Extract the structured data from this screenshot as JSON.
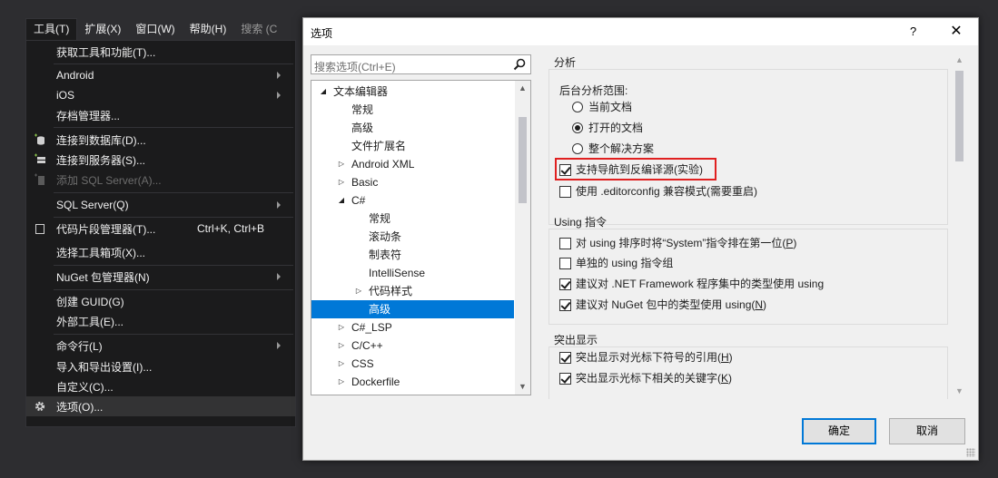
{
  "menubar": {
    "items": [
      "工具(T)",
      "扩展(X)",
      "窗口(W)",
      "帮助(H)",
      "搜索 (C"
    ]
  },
  "tools_menu": {
    "items": [
      {
        "label": "获取工具和功能(T)..."
      },
      {
        "label": "Android",
        "submenu": true
      },
      {
        "label": "iOS",
        "submenu": true
      },
      {
        "label": "存档管理器..."
      },
      {
        "label": "连接到数据库(D)...",
        "icon": "database-connect-icon"
      },
      {
        "label": "连接到服务器(S)...",
        "icon": "server-connect-icon"
      },
      {
        "label": "添加 SQL Server(A)...",
        "icon": "sql-server-add-icon",
        "disabled": true
      },
      {
        "label": "SQL Server(Q)",
        "submenu": true
      },
      {
        "label": "代码片段管理器(T)...",
        "shortcut": "Ctrl+K, Ctrl+B",
        "icon": "snippet-icon"
      },
      {
        "label": "选择工具箱项(X)..."
      },
      {
        "label": "NuGet 包管理器(N)",
        "submenu": true
      },
      {
        "label": "创建 GUID(G)"
      },
      {
        "label": "外部工具(E)..."
      },
      {
        "label": "命令行(L)",
        "submenu": true
      },
      {
        "label": "导入和导出设置(I)..."
      },
      {
        "label": "自定义(C)..."
      },
      {
        "label": "选项(O)...",
        "icon": "gear-icon",
        "highlighted": true
      }
    ]
  },
  "dialog": {
    "title": "选项",
    "help": "?",
    "close": "✕",
    "search_placeholder": "搜索选项(Ctrl+E)",
    "tree": [
      {
        "label": "文本编辑器",
        "level": 0,
        "expander": "expanded"
      },
      {
        "label": "常规",
        "level": 1
      },
      {
        "label": "高级",
        "level": 1
      },
      {
        "label": "文件扩展名",
        "level": 1
      },
      {
        "label": "Android XML",
        "level": 1,
        "expander": "collapsed"
      },
      {
        "label": "Basic",
        "level": 1,
        "expander": "collapsed"
      },
      {
        "label": "C#",
        "level": 1,
        "expander": "expanded"
      },
      {
        "label": "常规",
        "level": 2
      },
      {
        "label": "滚动条",
        "level": 2
      },
      {
        "label": "制表符",
        "level": 2
      },
      {
        "label": "IntelliSense",
        "level": 2
      },
      {
        "label": "代码样式",
        "level": 2,
        "expander": "collapsed"
      },
      {
        "label": "高级",
        "level": 2,
        "selected": true
      },
      {
        "label": "C#_LSP",
        "level": 1,
        "expander": "collapsed"
      },
      {
        "label": "C/C++",
        "level": 1,
        "expander": "collapsed"
      },
      {
        "label": "CSS",
        "level": 1,
        "expander": "collapsed"
      },
      {
        "label": "Dockerfile",
        "level": 1,
        "expander": "collapsed"
      }
    ],
    "sections": {
      "analysis": {
        "title": "分析",
        "scope_label": "后台分析范围:",
        "radio": [
          "当前文档",
          "打开的文档",
          "整个解决方案"
        ],
        "radio_selected": 1,
        "checkboxes": [
          {
            "label": "支持导航到反编译源(实验)",
            "checked": true
          },
          {
            "label": "使用 .editorconfig 兼容模式(需要重启)",
            "checked": false
          }
        ]
      },
      "using": {
        "title": "Using 指令",
        "checkboxes": [
          {
            "pre": "对 using 排序时将“System”指令排在第一位(",
            "key": "P",
            "post": ")",
            "checked": false
          },
          {
            "label": "单独的 using 指令组",
            "checked": false
          },
          {
            "label": "建议对 .NET Framework 程序集中的类型使用 using",
            "checked": true
          },
          {
            "pre": "建议对 NuGet 包中的类型使用 using(",
            "key": "N",
            "post": ")",
            "checked": true
          }
        ]
      },
      "highlight": {
        "title": "突出显示",
        "checkboxes": [
          {
            "pre": "突出显示对光标下符号的引用(",
            "key": "H",
            "post": ")",
            "checked": true
          },
          {
            "pre": "突出显示光标下相关的关键字(",
            "key": "K",
            "post": ")",
            "checked": true
          }
        ]
      }
    },
    "buttons": {
      "ok": "确定",
      "cancel": "取消"
    }
  },
  "colors": {
    "accent": "#0078d7",
    "highlight_box": "#e02020"
  }
}
